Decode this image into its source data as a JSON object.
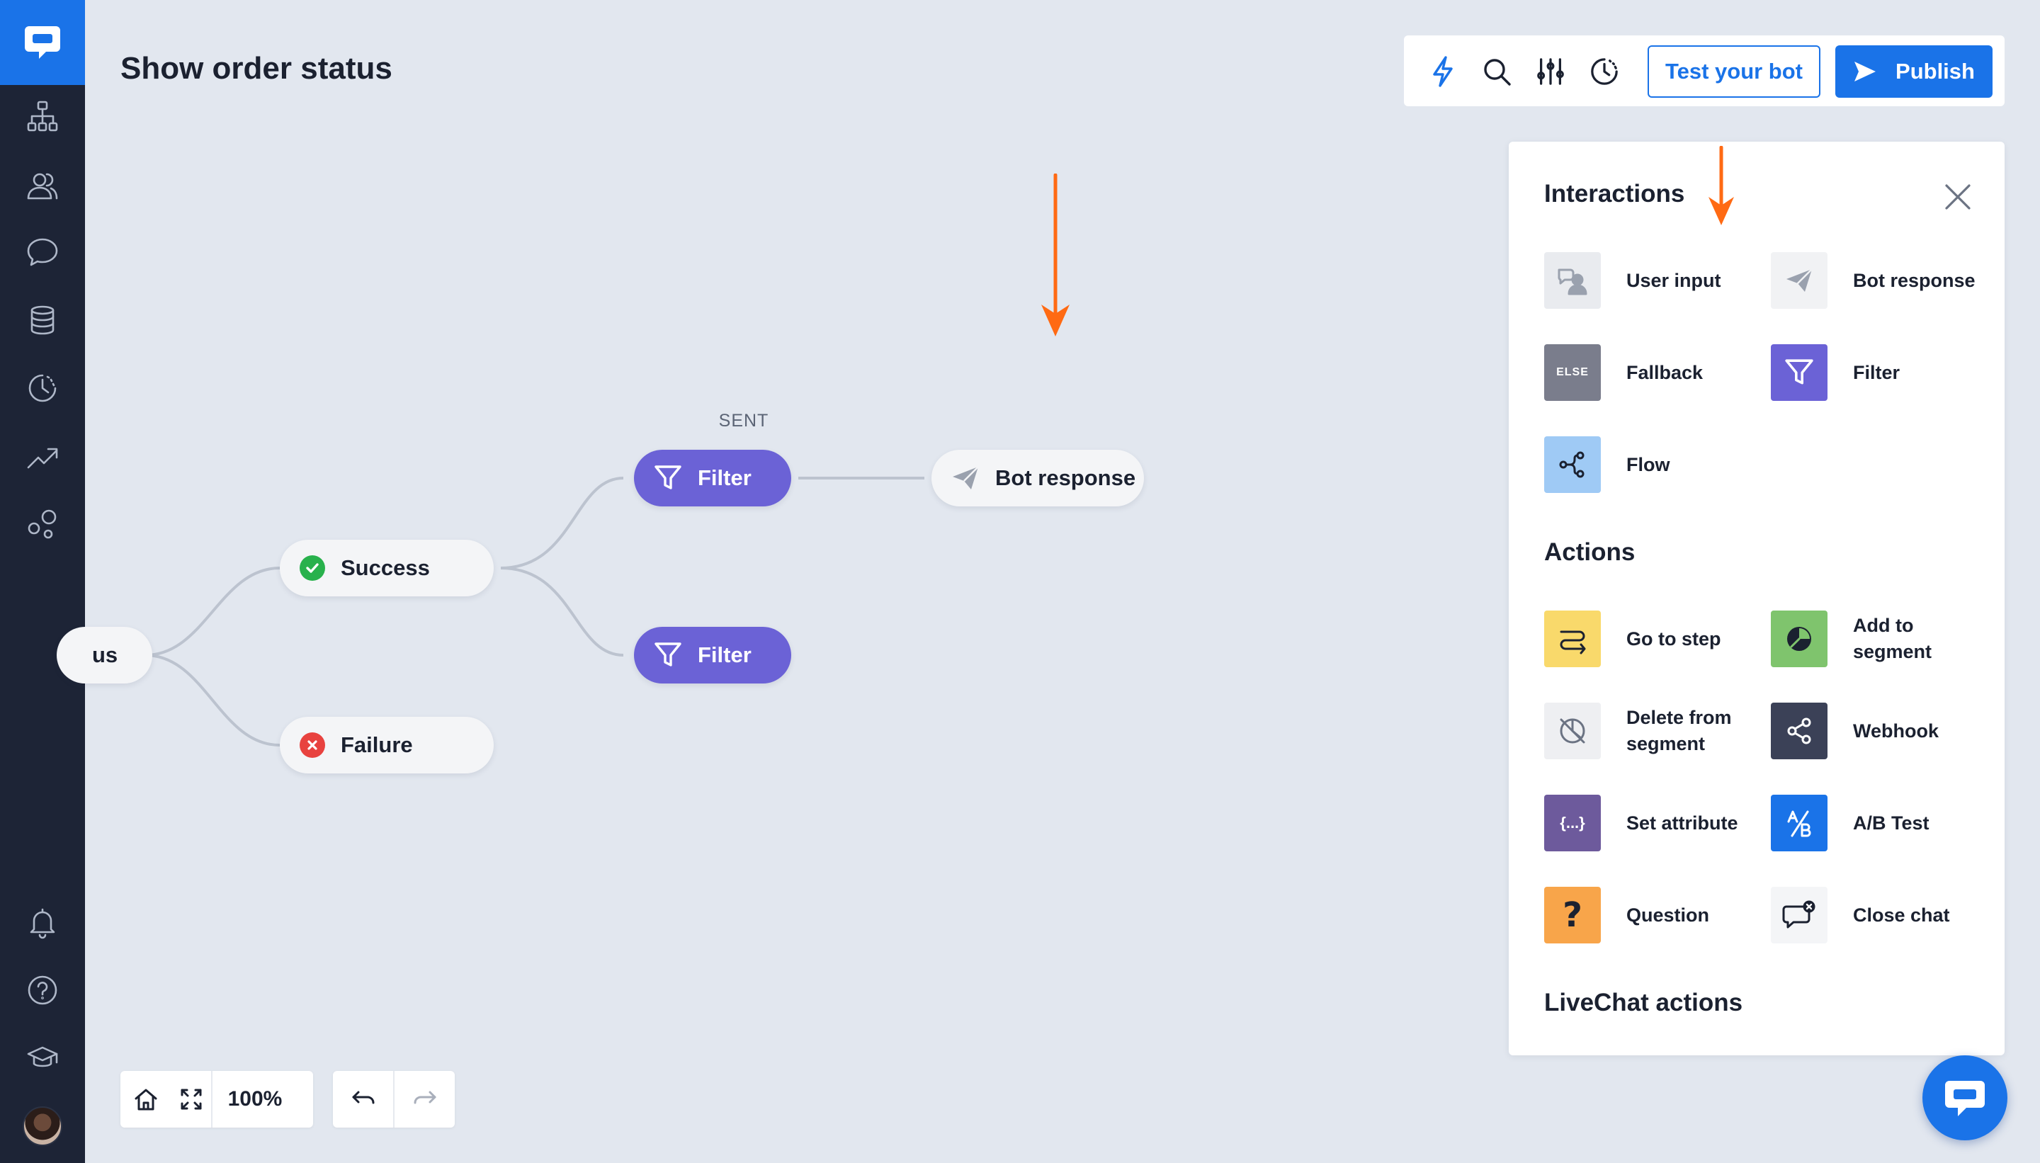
{
  "page": {
    "title": "Show order status"
  },
  "sidebar": {
    "items": [
      {
        "name": "stories"
      },
      {
        "name": "audience"
      },
      {
        "name": "conversations"
      },
      {
        "name": "knowledge"
      },
      {
        "name": "history"
      },
      {
        "name": "reports"
      },
      {
        "name": "integrations"
      }
    ],
    "bottom": [
      {
        "name": "notifications"
      },
      {
        "name": "help"
      },
      {
        "name": "academy"
      }
    ]
  },
  "toolbar": {
    "test_label": "Test your bot",
    "publish_label": "Publish"
  },
  "canvas": {
    "partial_node_label": "us",
    "success_label": "Success",
    "failure_label": "Failure",
    "filter_label_1": "Filter",
    "filter_label_2": "Filter",
    "sent_label": "SENT",
    "bot_response_label": "Bot response"
  },
  "controls": {
    "zoom": "100%"
  },
  "panel": {
    "interactions_heading": "Interactions",
    "actions_heading": "Actions",
    "livechat_heading": "LiveChat actions",
    "interactions": [
      {
        "label": "User input",
        "color": "#e9ebef"
      },
      {
        "label": "Bot response",
        "color": "#f1f2f4"
      },
      {
        "label": "Fallback",
        "color": "#7a7d8c",
        "tile_text": "ELSE"
      },
      {
        "label": "Filter",
        "color": "#6b62d6"
      },
      {
        "label": "Flow",
        "color": "#9fcaf5"
      }
    ],
    "actions": [
      {
        "label": "Go to step",
        "color": "#f9d96b"
      },
      {
        "label": "Add to segment",
        "color": "#7fc46d"
      },
      {
        "label": "Delete from segment",
        "color": "#eeeff2"
      },
      {
        "label": "Webhook",
        "color": "#3b4157"
      },
      {
        "label": "Set attribute",
        "color": "#6d5a9c",
        "tile_text": "{...}"
      },
      {
        "label": "A/B Test",
        "color": "#1a73e8"
      },
      {
        "label": "Question",
        "color": "#f8a54a",
        "tile_text": "?"
      },
      {
        "label": "Close chat",
        "color": "#f4f5f7"
      }
    ]
  },
  "colors": {
    "accent": "#1a73e8",
    "filter": "#6b62d6",
    "sidebar": "#1d2436",
    "annotation_arrow": "#ff6a13"
  }
}
